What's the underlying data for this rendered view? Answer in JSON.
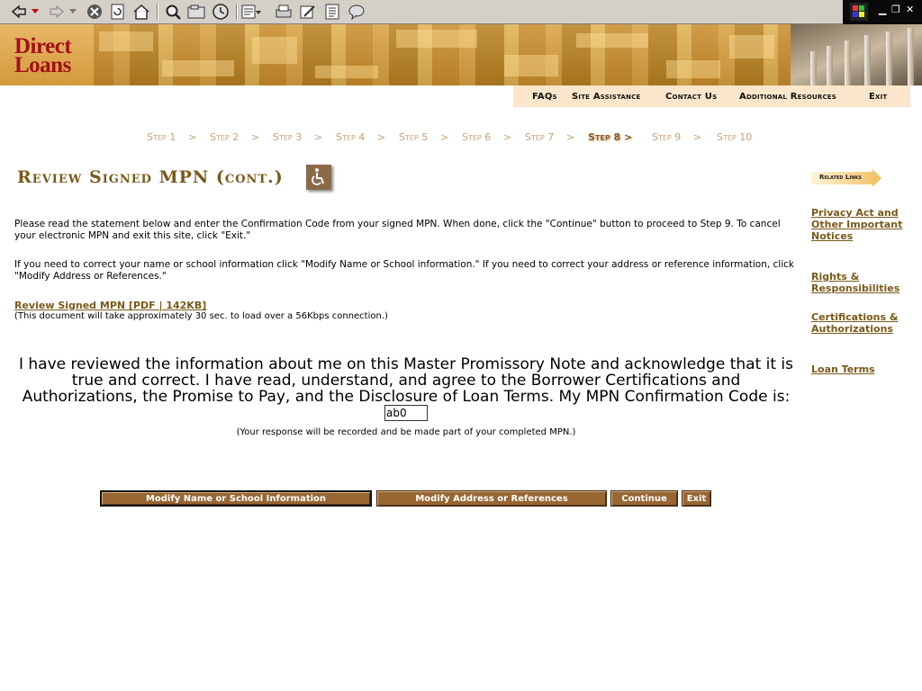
{
  "browser": {
    "toolbar_icons": [
      "back-icon",
      "dropdown-icon",
      "forward-icon",
      "dropdown-icon",
      "stop-icon",
      "refresh-icon",
      "home-icon",
      "search-icon",
      "favorites-icon",
      "history-icon",
      "mail-icon",
      "print-icon",
      "edit-icon",
      "notes-icon",
      "messenger-icon"
    ],
    "windows_logo": "windows-flag-icon"
  },
  "logo": {
    "line1": "Direct",
    "line2": "Loans"
  },
  "topnav": [
    "FAQs",
    "Site Assistance",
    "Contact Us",
    "Additional Resources",
    "Exit"
  ],
  "steps": [
    {
      "label": "Step 1",
      "sep": ">"
    },
    {
      "label": "Step 2",
      "sep": ">"
    },
    {
      "label": "Step 3",
      "sep": ">"
    },
    {
      "label": "Step 4",
      "sep": ">"
    },
    {
      "label": "Step 5",
      "sep": ">"
    },
    {
      "label": "Step 6",
      "sep": ">"
    },
    {
      "label": "Step 7",
      "sep": ">"
    },
    {
      "label": "Step 8 >",
      "sep": ""
    },
    {
      "label": "Step 9",
      "sep": ">"
    },
    {
      "label": "Step 10",
      "sep": ""
    }
  ],
  "current_step": "Step 8 >",
  "page": {
    "title": "Review Signed MPN (cont.)",
    "para1": "Please read the statement below and enter the Confirmation Code from your signed MPN. When done, click the \"Continue\" button to proceed to Step 9. To cancel your electronic MPN and exit this site, click \"Exit.\"",
    "para2": "If you need to correct your name or school information click \"Modify Name or School information.\" If you need to correct your address or reference information, click \"Modify Address or References.\"",
    "doc_link": "Review Signed MPN [PDF | 142KB]",
    "doc_note": "(This document will take approximately 30 sec. to load over a 56Kbps connection.)",
    "ack_text": "I have reviewed the information about me on this Master Promissory Note and acknowledge that it is true and correct. I have read, understand, and agree to the Borrower Certifications and Authorizations, the Promise to Pay, and the Disclosure of Loan Terms. My MPN Confirmation Code is:",
    "code_value": "ab0",
    "ack_note": "(Your response will be recorded and be made part of your completed MPN.)"
  },
  "buttons": {
    "modify_name": "Modify Name or School Information",
    "modify_address": "Modify Address or References",
    "continue": "Continue",
    "exit": "Exit"
  },
  "sidebar": {
    "badge": "Related Links",
    "links": [
      "Privacy Act and Other Important Notices",
      "Rights & Responsibilities",
      "Certifications & Authorizations",
      "Loan Terms"
    ]
  },
  "colors": {
    "brown": "#986633",
    "title": "#7a5a1a",
    "logo_red": "#a3101a",
    "step_inactive": "#c8a078",
    "nav_bg": "#fbe6cc"
  }
}
